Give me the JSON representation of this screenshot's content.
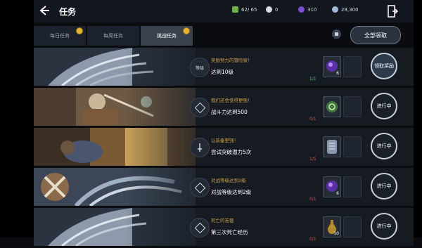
{
  "header": {
    "title": "任务",
    "resources": [
      {
        "icon": "energy-icon",
        "value": "62/ 65",
        "color": "#6fb04a"
      },
      {
        "icon": "gem-icon",
        "value": "0",
        "color": "#d8dbe0"
      },
      {
        "icon": "crystal-icon",
        "value": "310",
        "color": "#7a4cd0"
      },
      {
        "icon": "coin-icon",
        "value": "28,300",
        "color": "#9fb8d8"
      }
    ]
  },
  "tabs": [
    {
      "label": "每日任务",
      "active": false,
      "notify": true
    },
    {
      "label": "每周任务",
      "active": false,
      "notify": false
    },
    {
      "label": "挑战任务",
      "active": true,
      "notify": true
    }
  ],
  "claim_all_label": "全部领取",
  "quests": [
    {
      "badge": "等级",
      "subtitle": "奖励努力的冒险家！",
      "title": "达到10级",
      "progress": "1/1",
      "progress_color": "#5bbf6a",
      "reward_icon": "purple-orb-icon",
      "reward_color": "#5a2fa8",
      "reward_count": "6",
      "action": "领取奖励",
      "art": "wing-art"
    },
    {
      "badge": "",
      "subtitle": "我们还会变得更强！",
      "title": "战斗力达到500",
      "progress": "0/1",
      "progress_color": "#d2574a",
      "reward_icon": "green-rune-icon",
      "reward_color": "#3d7a3a",
      "reward_count": "",
      "action": "进行中",
      "art": "knight-art"
    },
    {
      "badge": "",
      "subtitle": "让装备更强！",
      "title": "尝试突破潜力5次",
      "progress": "1/5",
      "progress_color": "#d2574a",
      "reward_icon": "scroll-icon",
      "reward_color": "#8a97b0",
      "reward_count": "",
      "action": "进行中",
      "art": "warrior-art"
    },
    {
      "badge": "",
      "subtitle": "对战等级达到2级",
      "title": "对战等级达到2级",
      "progress": "0/1",
      "progress_color": "#d2574a",
      "reward_icon": "purple-orb-icon",
      "reward_color": "#5a2fa8",
      "reward_count": "6",
      "action": "进行中",
      "art": "crest-art"
    },
    {
      "badge": "",
      "subtitle": "死亡的苦楚",
      "title": "第三次死亡经历",
      "progress": "0/1",
      "progress_color": "#d2574a",
      "reward_icon": "potion-icon",
      "reward_color": "#b58a2a",
      "reward_count": "10",
      "action": "进行中",
      "art": "wing-art"
    }
  ]
}
